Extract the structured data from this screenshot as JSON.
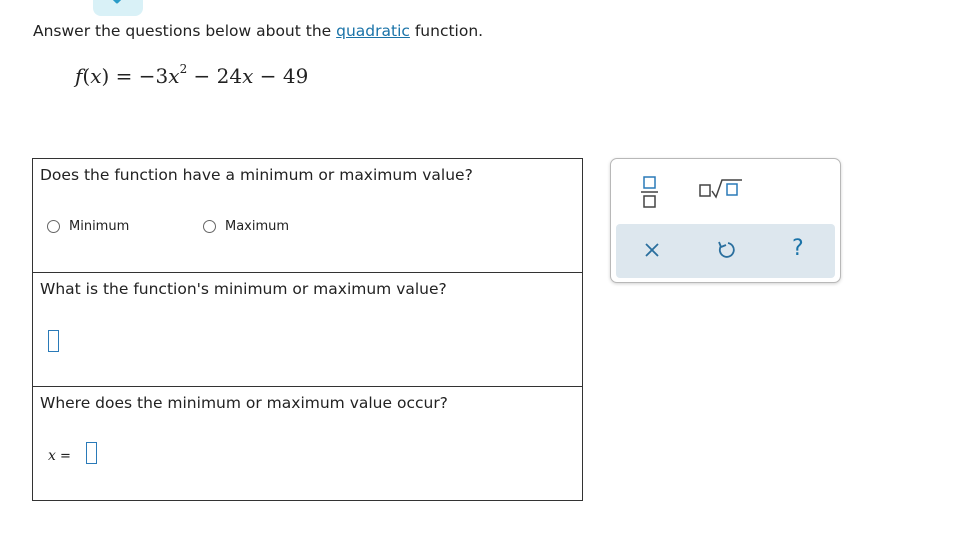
{
  "instructions": {
    "prefix": "Answer the questions below about the ",
    "link": "quadratic",
    "suffix": " function."
  },
  "formula": {
    "fname": "f",
    "arg": "x",
    "rhs_a": " = −3",
    "rhs_x": "x",
    "rhs_exp": "2",
    "rhs_b": " − 24",
    "rhs_x2": "x",
    "rhs_c": " − 49"
  },
  "questions": {
    "q1": {
      "text": "Does the function have a minimum or maximum value?",
      "options": [
        "Minimum",
        "Maximum"
      ]
    },
    "q2": {
      "text": "What is the function's minimum or maximum value?"
    },
    "q3": {
      "text": "Where does the minimum or maximum value occur?",
      "var": "x",
      "eq": " ="
    }
  },
  "tools": {
    "icons": [
      "fraction-icon",
      "sqrt-icon",
      "clear-icon",
      "undo-icon",
      "help-icon"
    ],
    "help_label": "?",
    "accent": "#1a73a8",
    "panel_bg": "#dde7ee"
  }
}
